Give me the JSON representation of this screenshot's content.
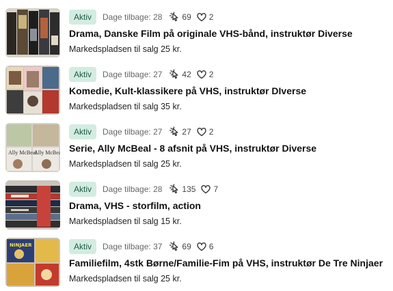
{
  "listings": [
    {
      "status": "Aktiv",
      "days_back": "Dage tilbage: 28",
      "clicks": "69",
      "likes": "2",
      "title": "Drama, Danske Film på originale VHS-bånd, instruktør Diverse",
      "subtitle": "Markedspladsen til salg 25 kr.",
      "thumb_icon": "vhs-stack-photo"
    },
    {
      "status": "Aktiv",
      "days_back": "Dage tilbage: 27",
      "clicks": "42",
      "likes": "2",
      "title": "Komedie, Kult-klassikere på VHS, instruktør DIverse",
      "subtitle": "Markedspladsen til salg 35 kr.",
      "thumb_icon": "vhs-covers-photo"
    },
    {
      "status": "Aktiv",
      "days_back": "Dage tilbage: 27",
      "clicks": "27",
      "likes": "2",
      "title": "Serie, Ally McBeal - 8 afsnit på VHS, instruktør Diverse",
      "subtitle": "Markedspladsen til salg 25 kr.",
      "thumb_icon": "ally-mcbeal-covers-photo",
      "thumb_text": "Ally McBeal"
    },
    {
      "status": "Aktiv",
      "days_back": "Dage tilbage: 28",
      "clicks": "135",
      "likes": "7",
      "title": "Drama, VHS - storfilm, action",
      "subtitle": "Markedspladsen til salg 15 kr.",
      "thumb_icon": "vhs-spines-photo"
    },
    {
      "status": "Aktiv",
      "days_back": "Dage tilbage: 37",
      "clicks": "69",
      "likes": "6",
      "title": "Familiefilm, 4stk Børne/Familie-Fim på VHS, instruktør De Tre Ninjaer",
      "subtitle": "Markedspladsen til salg 25 kr.",
      "thumb_icon": "kids-vhs-covers-photo",
      "thumb_text": "NINJAER"
    }
  ],
  "icons": {
    "clicks": "cursor-click-icon",
    "likes": "heart-icon"
  },
  "colors": {
    "badge_bg": "#d3ece1",
    "badge_text": "#1f5a44",
    "text": "#111111",
    "muted": "#666666"
  }
}
